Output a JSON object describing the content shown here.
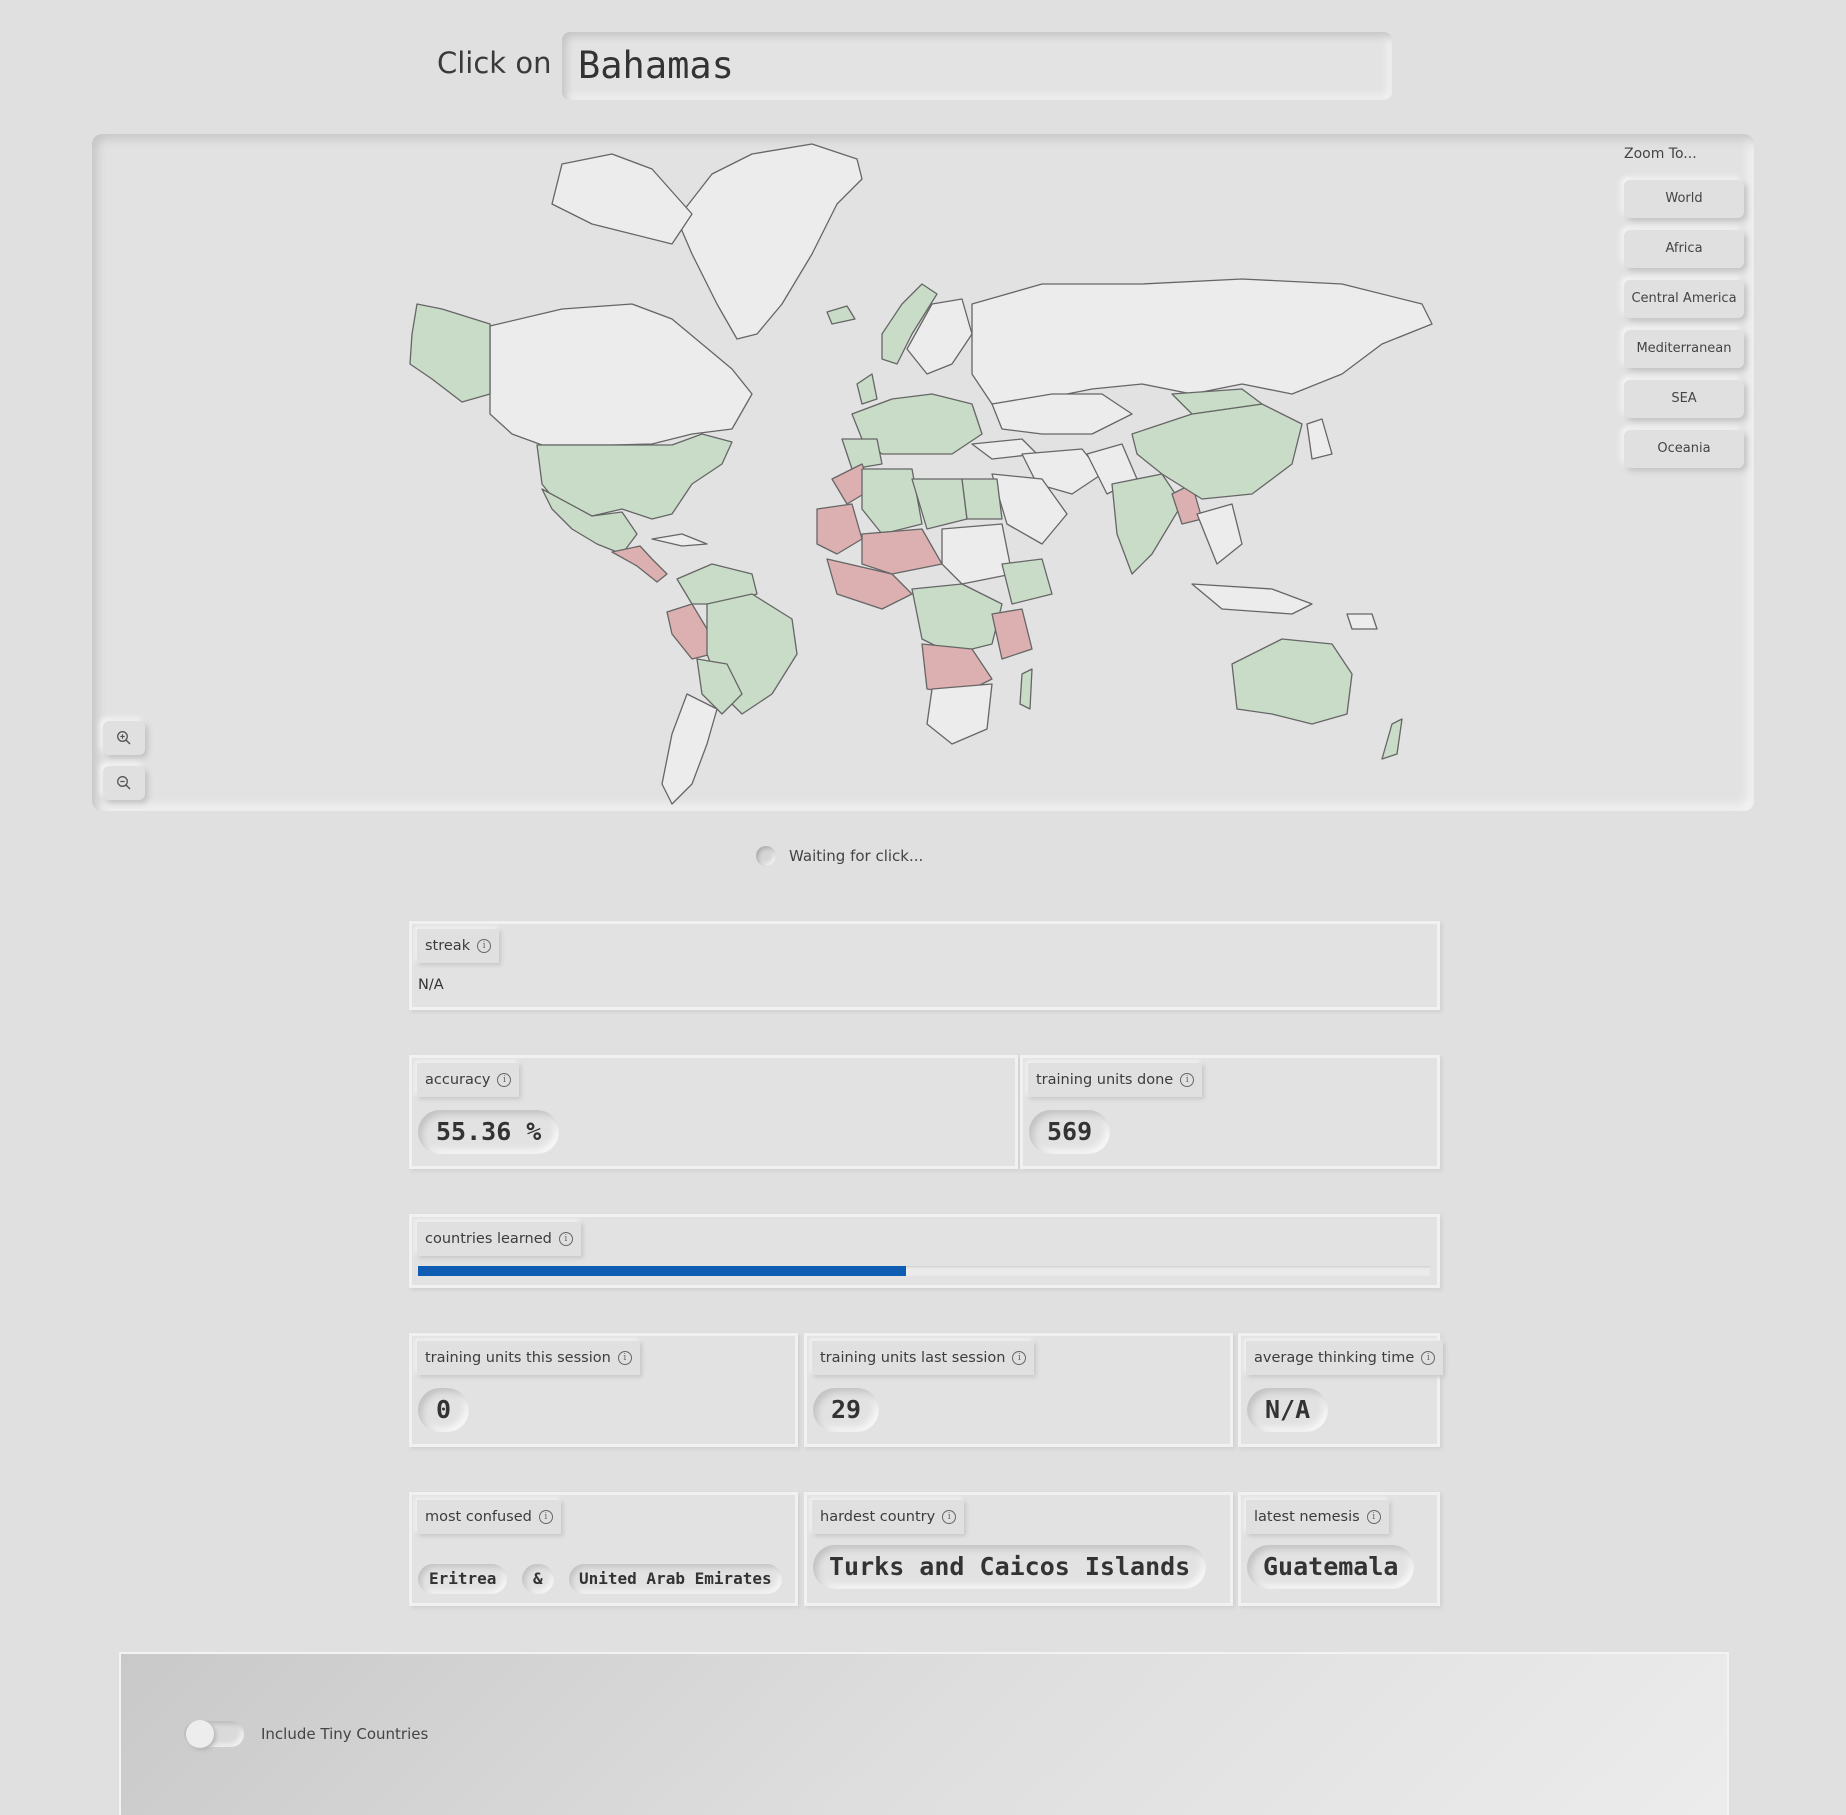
{
  "prompt": {
    "label": "Click on",
    "country": "Bahamas"
  },
  "zoom": {
    "title": "Zoom To...",
    "options": [
      "World",
      "Africa",
      "Central America",
      "Mediterranean",
      "SEA",
      "Oceania"
    ]
  },
  "map_controls": {
    "zoom_in_icon": "zoom-in-icon",
    "zoom_out_icon": "zoom-out-icon"
  },
  "map_colors": {
    "learned": "#c8dcc8",
    "struggling": "#dcb0b0",
    "unseen": "#ececec",
    "border": "#666666"
  },
  "status": {
    "text": "Waiting for click..."
  },
  "stats": {
    "streak": {
      "label": "streak",
      "value": "N/A"
    },
    "accuracy": {
      "label": "accuracy",
      "value": "55.36 %"
    },
    "training_units_done": {
      "label": "training units done",
      "value": "569"
    },
    "countries_learned": {
      "label": "countries learned",
      "progress": 0.482,
      "color": "#0e5db3"
    },
    "training_units_this_session": {
      "label": "training units this session",
      "value": "0"
    },
    "training_units_last_session": {
      "label": "training units last session",
      "value": "29"
    },
    "average_thinking_time": {
      "label": "average thinking time",
      "value": "N/A"
    },
    "most_confused": {
      "label": "most confused",
      "a": "Eritrea",
      "amp": "&",
      "b": "United Arab Emirates"
    },
    "hardest_country": {
      "label": "hardest country",
      "value": "Turks and Caicos Islands"
    },
    "latest_nemesis": {
      "label": "latest nemesis",
      "value": "Guatemala"
    }
  },
  "options": {
    "tiny_countries_label": "Include Tiny Countries",
    "tiny_countries_enabled": false
  }
}
